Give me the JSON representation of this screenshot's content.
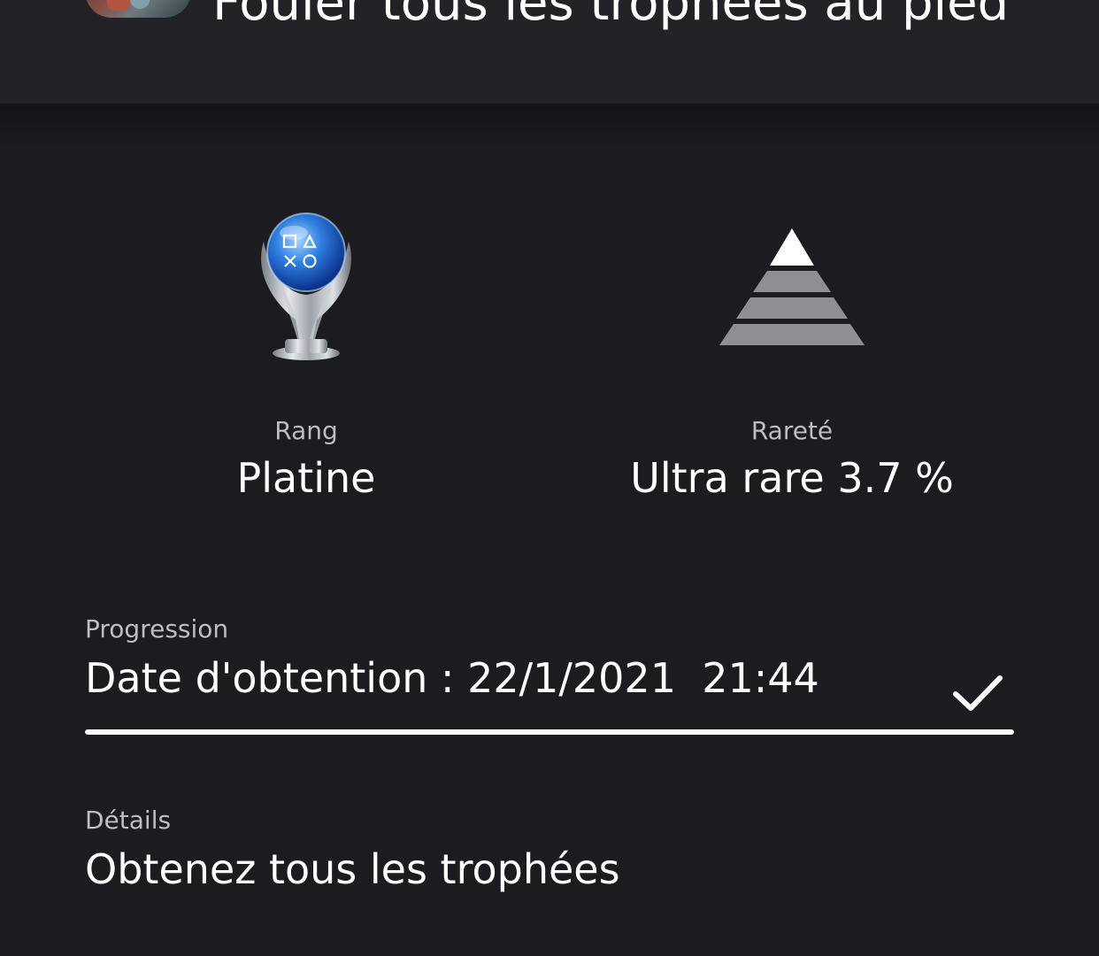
{
  "header": {
    "title": "Fouler tous les trophées au pied"
  },
  "rank": {
    "label": "Rang",
    "value": "Platine"
  },
  "rarity": {
    "label": "Rareté",
    "value": "Ultra rare 3.7 %"
  },
  "progress": {
    "label": "Progression",
    "value": "Date d'obtention : 22/1/2021  21:44",
    "fraction": 1.0
  },
  "details": {
    "label": "Détails",
    "value": "Obtenez tous les trophées"
  },
  "icons": {
    "trophy": "platinum-trophy-icon",
    "rarity": "rarity-pyramid-icon",
    "check": "checkmark-icon"
  },
  "colors": {
    "background": "#1b1b20",
    "header": "#222227",
    "label": "#bdbdc2",
    "text": "#ffffff"
  }
}
